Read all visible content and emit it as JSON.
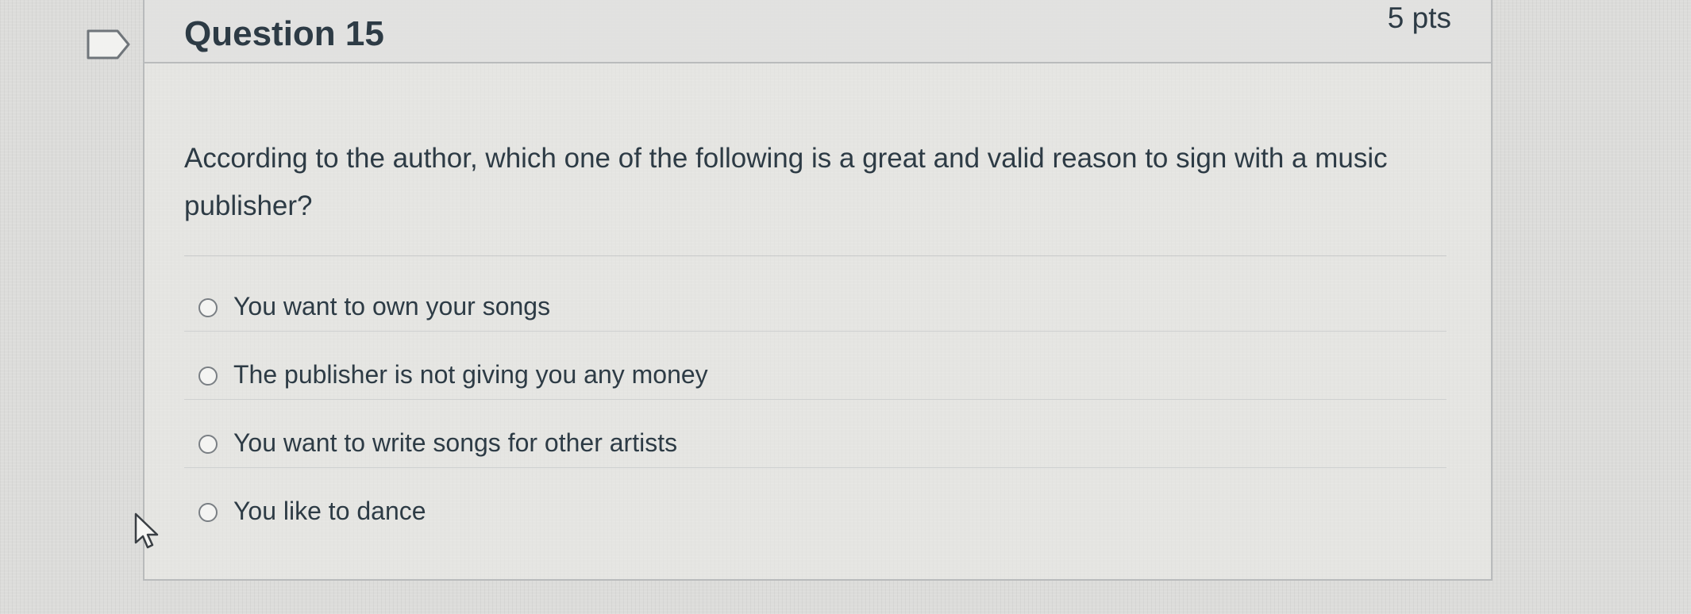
{
  "question": {
    "title": "Question 15",
    "points": "5 pts",
    "text": "According to the author, which one of the following is a great and valid reason to sign with a music publisher?",
    "flag_icon": "flag-question-icon",
    "answers": [
      {
        "label": "You want to own your songs",
        "selected": false
      },
      {
        "label": "The publisher is not giving you any money",
        "selected": false
      },
      {
        "label": "You want to write songs for other artists",
        "selected": false
      },
      {
        "label": "You like to dance",
        "selected": false
      }
    ]
  },
  "pointer": {
    "icon": "mouse-pointer-icon"
  },
  "colors": {
    "text": "#2d3b45",
    "border": "#b9bbbc",
    "background": "#dcdcda"
  }
}
